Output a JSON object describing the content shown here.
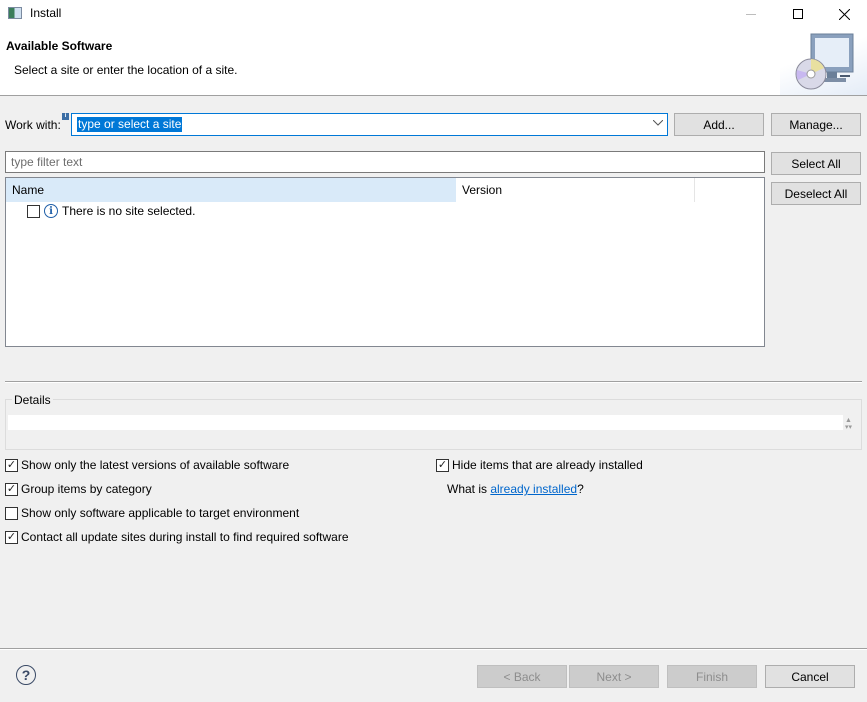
{
  "window": {
    "title": "Install",
    "controls": {
      "minimize": "—",
      "maximize": "☐",
      "close": "✕"
    }
  },
  "header": {
    "title": "Available Software",
    "description": "Select a site or enter the location of a site.",
    "banner_icon": "install-wizard-monitor-cd-icon"
  },
  "work_with": {
    "label": "Work with:",
    "value": "type or select a site",
    "dropdown_icon": "chevron-down-icon",
    "add_label": "Add...",
    "manage_label": "Manage..."
  },
  "filter": {
    "placeholder": "type filter text"
  },
  "selection_buttons": {
    "select_all": "Select All",
    "deselect_all": "Deselect All"
  },
  "table": {
    "columns": [
      "Name",
      "Version"
    ],
    "rows": [
      {
        "checked": false,
        "icon": "info-icon",
        "name": "There is no site selected.",
        "version": ""
      }
    ]
  },
  "details": {
    "label": "Details",
    "text": ""
  },
  "options": [
    {
      "label": "Show only the latest versions of available software",
      "checked": true
    },
    {
      "label": "Group items by category",
      "checked": true
    },
    {
      "label": "Show only software applicable to target environment",
      "checked": false
    },
    {
      "label": "Contact all update sites during install to find required software",
      "checked": true
    },
    {
      "label": "Hide items that are already installed",
      "checked": true
    }
  ],
  "already_installed": {
    "prefix": "What is ",
    "link": "already installed",
    "suffix": "?"
  },
  "footer": {
    "help_icon": "help-icon",
    "back": "< Back",
    "next": "Next >",
    "finish": "Finish",
    "cancel": "Cancel"
  }
}
